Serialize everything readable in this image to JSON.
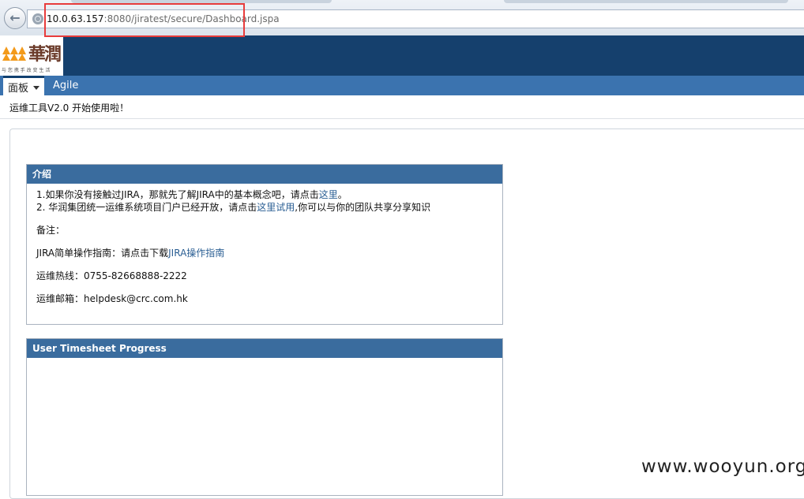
{
  "browser": {
    "url_host": "10.0.63.157",
    "url_rest": ":8080/jiratest/secure/Dashboard.jspa"
  },
  "logo": {
    "chars": "華潤",
    "slogan": "与 您 携 手  改 变 生 活"
  },
  "nav": {
    "dashboards": "面板",
    "agile": "Agile"
  },
  "announcement": "运维工具V2.0 开始使用啦！",
  "intro_gadget": {
    "title": "介绍",
    "line1_pre": "1.如果你没有接触过JIRA，那就先了解JIRA中的基本概念吧，请点击",
    "line1_link": "这里",
    "line1_post": "。",
    "line2_pre": "2. 华润集团统一运维系统项目门户已经开放，请点击",
    "line2_link": "这里试用",
    "line2_post": ",你可以与你的团队共享分享知识",
    "note_label": "备注：",
    "guide_pre": "JIRA简单操作指南：请点击下载",
    "guide_link": "JIRA操作指南",
    "hotline": "运维热线：0755-82668888-2222",
    "email": "运维邮箱：helpdesk@crc.com.hk"
  },
  "timesheet_gadget": {
    "title": "User Timesheet Progress"
  },
  "watermark": "www.wooyun.org",
  "colors": {
    "header": "#15406d",
    "nav": "#3b73af",
    "gadget_title": "#3a6c9e",
    "highlight": "#e83c3c"
  }
}
